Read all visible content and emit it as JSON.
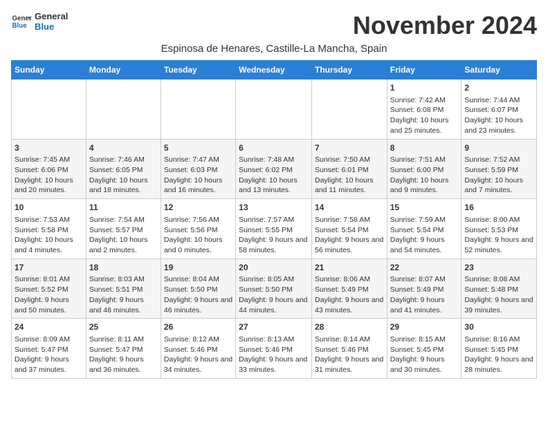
{
  "header": {
    "logo_line1": "General",
    "logo_line2": "Blue",
    "month_title": "November 2024",
    "location": "Espinosa de Henares, Castille-La Mancha, Spain"
  },
  "columns": [
    "Sunday",
    "Monday",
    "Tuesday",
    "Wednesday",
    "Thursday",
    "Friday",
    "Saturday"
  ],
  "weeks": [
    [
      {
        "day": "",
        "info": ""
      },
      {
        "day": "",
        "info": ""
      },
      {
        "day": "",
        "info": ""
      },
      {
        "day": "",
        "info": ""
      },
      {
        "day": "",
        "info": ""
      },
      {
        "day": "1",
        "info": "Sunrise: 7:42 AM\nSunset: 6:08 PM\nDaylight: 10 hours and 25 minutes."
      },
      {
        "day": "2",
        "info": "Sunrise: 7:44 AM\nSunset: 6:07 PM\nDaylight: 10 hours and 23 minutes."
      }
    ],
    [
      {
        "day": "3",
        "info": "Sunrise: 7:45 AM\nSunset: 6:06 PM\nDaylight: 10 hours and 20 minutes."
      },
      {
        "day": "4",
        "info": "Sunrise: 7:46 AM\nSunset: 6:05 PM\nDaylight: 10 hours and 18 minutes."
      },
      {
        "day": "5",
        "info": "Sunrise: 7:47 AM\nSunset: 6:03 PM\nDaylight: 10 hours and 16 minutes."
      },
      {
        "day": "6",
        "info": "Sunrise: 7:48 AM\nSunset: 6:02 PM\nDaylight: 10 hours and 13 minutes."
      },
      {
        "day": "7",
        "info": "Sunrise: 7:50 AM\nSunset: 6:01 PM\nDaylight: 10 hours and 11 minutes."
      },
      {
        "day": "8",
        "info": "Sunrise: 7:51 AM\nSunset: 6:00 PM\nDaylight: 10 hours and 9 minutes."
      },
      {
        "day": "9",
        "info": "Sunrise: 7:52 AM\nSunset: 5:59 PM\nDaylight: 10 hours and 7 minutes."
      }
    ],
    [
      {
        "day": "10",
        "info": "Sunrise: 7:53 AM\nSunset: 5:58 PM\nDaylight: 10 hours and 4 minutes."
      },
      {
        "day": "11",
        "info": "Sunrise: 7:54 AM\nSunset: 5:57 PM\nDaylight: 10 hours and 2 minutes."
      },
      {
        "day": "12",
        "info": "Sunrise: 7:56 AM\nSunset: 5:56 PM\nDaylight: 10 hours and 0 minutes."
      },
      {
        "day": "13",
        "info": "Sunrise: 7:57 AM\nSunset: 5:55 PM\nDaylight: 9 hours and 58 minutes."
      },
      {
        "day": "14",
        "info": "Sunrise: 7:58 AM\nSunset: 5:54 PM\nDaylight: 9 hours and 56 minutes."
      },
      {
        "day": "15",
        "info": "Sunrise: 7:59 AM\nSunset: 5:54 PM\nDaylight: 9 hours and 54 minutes."
      },
      {
        "day": "16",
        "info": "Sunrise: 8:00 AM\nSunset: 5:53 PM\nDaylight: 9 hours and 52 minutes."
      }
    ],
    [
      {
        "day": "17",
        "info": "Sunrise: 8:01 AM\nSunset: 5:52 PM\nDaylight: 9 hours and 50 minutes."
      },
      {
        "day": "18",
        "info": "Sunrise: 8:03 AM\nSunset: 5:51 PM\nDaylight: 9 hours and 48 minutes."
      },
      {
        "day": "19",
        "info": "Sunrise: 8:04 AM\nSunset: 5:50 PM\nDaylight: 9 hours and 46 minutes."
      },
      {
        "day": "20",
        "info": "Sunrise: 8:05 AM\nSunset: 5:50 PM\nDaylight: 9 hours and 44 minutes."
      },
      {
        "day": "21",
        "info": "Sunrise: 8:06 AM\nSunset: 5:49 PM\nDaylight: 9 hours and 43 minutes."
      },
      {
        "day": "22",
        "info": "Sunrise: 8:07 AM\nSunset: 5:49 PM\nDaylight: 9 hours and 41 minutes."
      },
      {
        "day": "23",
        "info": "Sunrise: 8:08 AM\nSunset: 5:48 PM\nDaylight: 9 hours and 39 minutes."
      }
    ],
    [
      {
        "day": "24",
        "info": "Sunrise: 8:09 AM\nSunset: 5:47 PM\nDaylight: 9 hours and 37 minutes."
      },
      {
        "day": "25",
        "info": "Sunrise: 8:11 AM\nSunset: 5:47 PM\nDaylight: 9 hours and 36 minutes."
      },
      {
        "day": "26",
        "info": "Sunrise: 8:12 AM\nSunset: 5:46 PM\nDaylight: 9 hours and 34 minutes."
      },
      {
        "day": "27",
        "info": "Sunrise: 8:13 AM\nSunset: 5:46 PM\nDaylight: 9 hours and 33 minutes."
      },
      {
        "day": "28",
        "info": "Sunrise: 8:14 AM\nSunset: 5:46 PM\nDaylight: 9 hours and 31 minutes."
      },
      {
        "day": "29",
        "info": "Sunrise: 8:15 AM\nSunset: 5:45 PM\nDaylight: 9 hours and 30 minutes."
      },
      {
        "day": "30",
        "info": "Sunrise: 8:16 AM\nSunset: 5:45 PM\nDaylight: 9 hours and 28 minutes."
      }
    ]
  ]
}
